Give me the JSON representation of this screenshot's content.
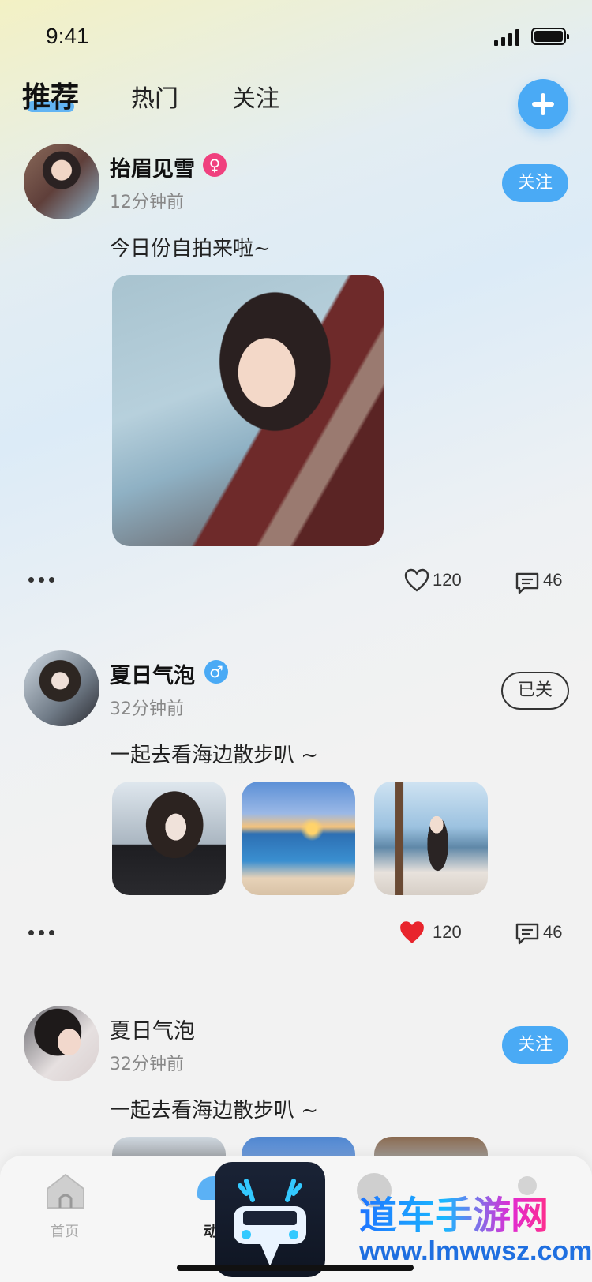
{
  "status_bar": {
    "time": "9:41"
  },
  "tabs": [
    {
      "label": "推荐",
      "active": true
    },
    {
      "label": "热门",
      "active": false
    },
    {
      "label": "关注",
      "active": false
    }
  ],
  "posts": [
    {
      "name": "抬眉见雪",
      "gender": "female",
      "gender_symbol": "♀",
      "time": "12分钟前",
      "text": "今日份自拍来啦~",
      "follow_label": "关注",
      "likes": "120",
      "liked": false,
      "comments": "46"
    },
    {
      "name": "夏日气泡",
      "gender": "male",
      "gender_symbol": "♂",
      "time": "32分钟前",
      "text": "一起去看海边散步叭 ~",
      "follow_label": "已关",
      "likes": "120",
      "liked": true,
      "comments": "46"
    },
    {
      "name": "夏日气泡",
      "time": "32分钟前",
      "text": "一起去看海边散步叭 ~",
      "follow_label": "关注"
    }
  ],
  "bottom_nav": [
    {
      "label": "首页",
      "icon": "home-icon"
    },
    {
      "label": "动",
      "icon": "moments-icon"
    }
  ],
  "watermark": {
    "cn": "道车手游网",
    "url": "www.lmwwsz.com"
  },
  "colors": {
    "accent": "#4aaaf5",
    "female": "#f0407e",
    "male": "#4aaaf5",
    "like": "#e8242c"
  }
}
